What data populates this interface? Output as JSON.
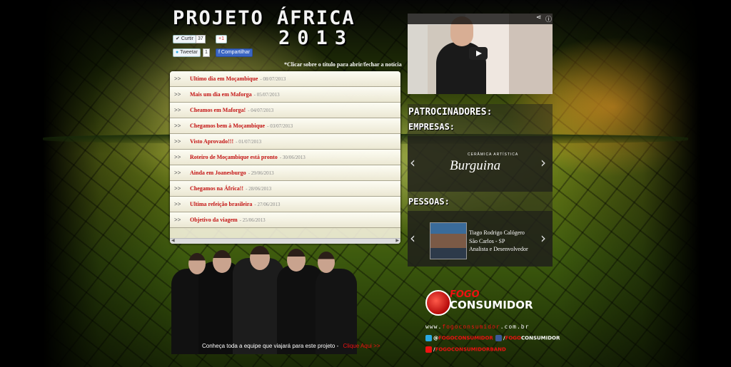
{
  "header": {
    "title": "PROJETO ÁFRICA",
    "year": "2013",
    "like_label": "Curtir",
    "like_count": "37",
    "plusone_label": "+1",
    "tweet_label": "Tweetar",
    "tweet_count": "1",
    "share_label": "Compartilhar",
    "hint": "*Clicar sobre o título para abrir/fechar a notícia"
  },
  "news": [
    {
      "title": "Ultimo dia em Moçambique",
      "date": " - 08/07/2013"
    },
    {
      "title": "Mais um dia em Maforga",
      "date": " - 05/07/2013"
    },
    {
      "title": "Cheamos em Maforga!",
      "date": " - 04/07/2013"
    },
    {
      "title": "Chegamos bem à Moçambique",
      "date": " - 03/07/2013"
    },
    {
      "title": "Visto Aprovado!!!",
      "date": " - 01/07/2013"
    },
    {
      "title": "Roteiro de Moçambique está pronto",
      "date": " - 30/06/2013"
    },
    {
      "title": "Ainda em Joanesburgo",
      "date": " - 29/06/2013"
    },
    {
      "title": "Chegamos na África!!",
      "date": " - 28/06/2013"
    },
    {
      "title": "Ultima refeição brasileira",
      "date": " - 27/06/2013"
    },
    {
      "title": "Objetivo da viagem",
      "date": " - 25/06/2013"
    }
  ],
  "team": {
    "caption": "Conheça toda a equipe que viajará para este projeto -",
    "link": "Clique Aqui >>"
  },
  "sponsors": {
    "heading": "PATROCINADORES:",
    "companies_label": "EMPRESAS:",
    "company_tagline": "CERÂMICA ARTÍSTICA",
    "company_name": "Burguina",
    "people_label": "PESSOAS:",
    "person_name": "Tiago Rodrigo Calógero",
    "person_city": "São Carlos - SP",
    "person_role": "Analista e Desenvolvedor"
  },
  "brand": {
    "top": "FOGO",
    "bottom": "CONSUMIDOR",
    "site_prefix": "www.",
    "site_name": "fogoconsumidor",
    "site_suffix": ".com.br",
    "twitter_prefix": "@",
    "twitter_handle": "FOGOCONSUMIDOR",
    "facebook_prefix": "/",
    "facebook_red": "FOGO",
    "facebook_white": "CONSUMIDOR",
    "youtube_prefix": "/",
    "youtube_handle": "FOGOCONSUMIDORBAND"
  },
  "colors": {
    "accent_red": "#c31111",
    "panel": "#faf6e2"
  }
}
